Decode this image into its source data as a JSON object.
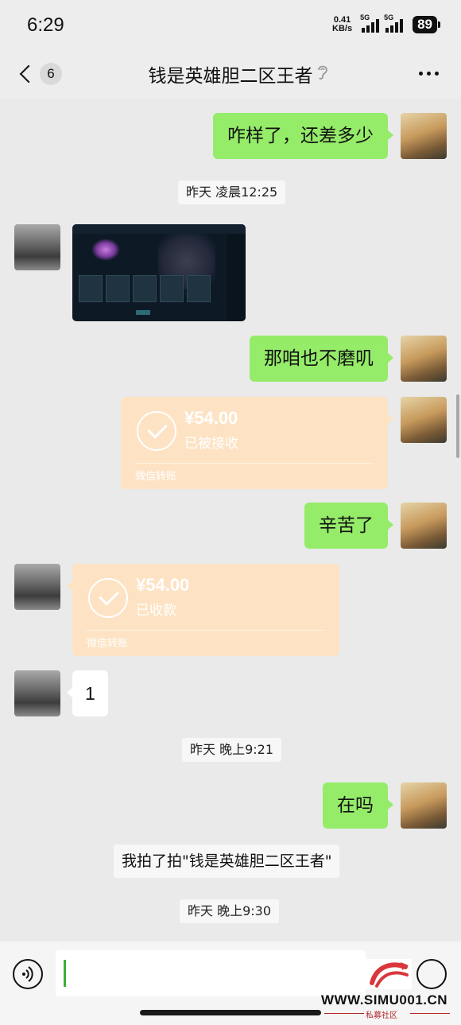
{
  "status_bar": {
    "time": "6:29",
    "net_speed_value": "0.41",
    "net_speed_unit": "KB/s",
    "signal1_label": "5G",
    "signal2_label": "5G",
    "battery": "89"
  },
  "nav": {
    "unread_count": "6",
    "title": "钱是英雄胆二区王者"
  },
  "messages": {
    "m1": "咋样了，还差多少",
    "t1": "昨天 凌晨12:25",
    "m3": "那咱也不磨叽",
    "transfer1": {
      "amount": "¥54.00",
      "status": "已被接收",
      "footer": "微信转账"
    },
    "m5": "辛苦了",
    "transfer2": {
      "amount": "¥54.00",
      "status": "已收款",
      "footer": "微信转账"
    },
    "m7": "1",
    "t2": "昨天 晚上9:21",
    "m8": "在吗",
    "system_pat": "我拍了拍\"钱是英雄胆二区王者\"",
    "t3": "昨天 晚上9:30"
  },
  "watermark": {
    "site": "WWW.SIMU001.CN",
    "label": "私募社区"
  },
  "colors": {
    "sent_bubble": "#95ec69",
    "received_bubble": "#ffffff",
    "transfer": "#fde3c4",
    "background": "#ededed",
    "cursor": "#3cb034"
  }
}
